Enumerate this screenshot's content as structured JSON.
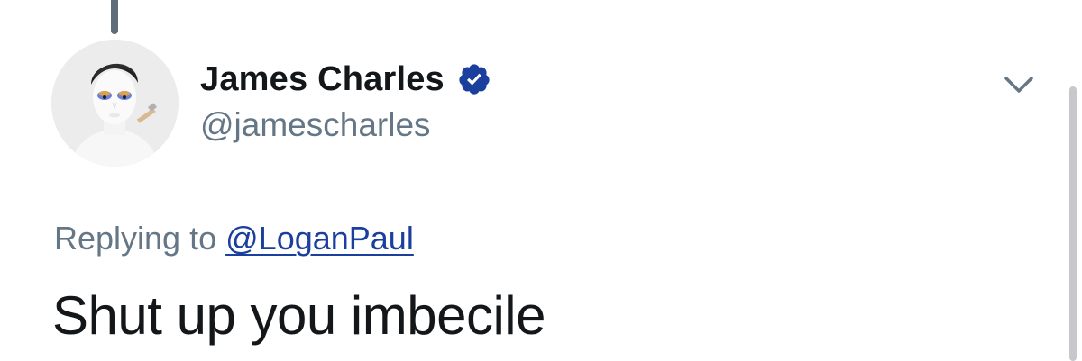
{
  "tweet": {
    "author": {
      "display_name": "James Charles",
      "handle": "@jamescharles",
      "verified": true
    },
    "reply": {
      "prefix": "Replying to",
      "mention": "@LoganPaul"
    },
    "text": "Shut up you imbecile"
  },
  "icons": {
    "verified": "verified-badge-icon",
    "more": "chevron-down-icon"
  },
  "colors": {
    "verified_blue": "#1b3f9c",
    "text_primary": "#14171a",
    "text_secondary": "#657786",
    "thread_line": "#5f6d7a"
  }
}
